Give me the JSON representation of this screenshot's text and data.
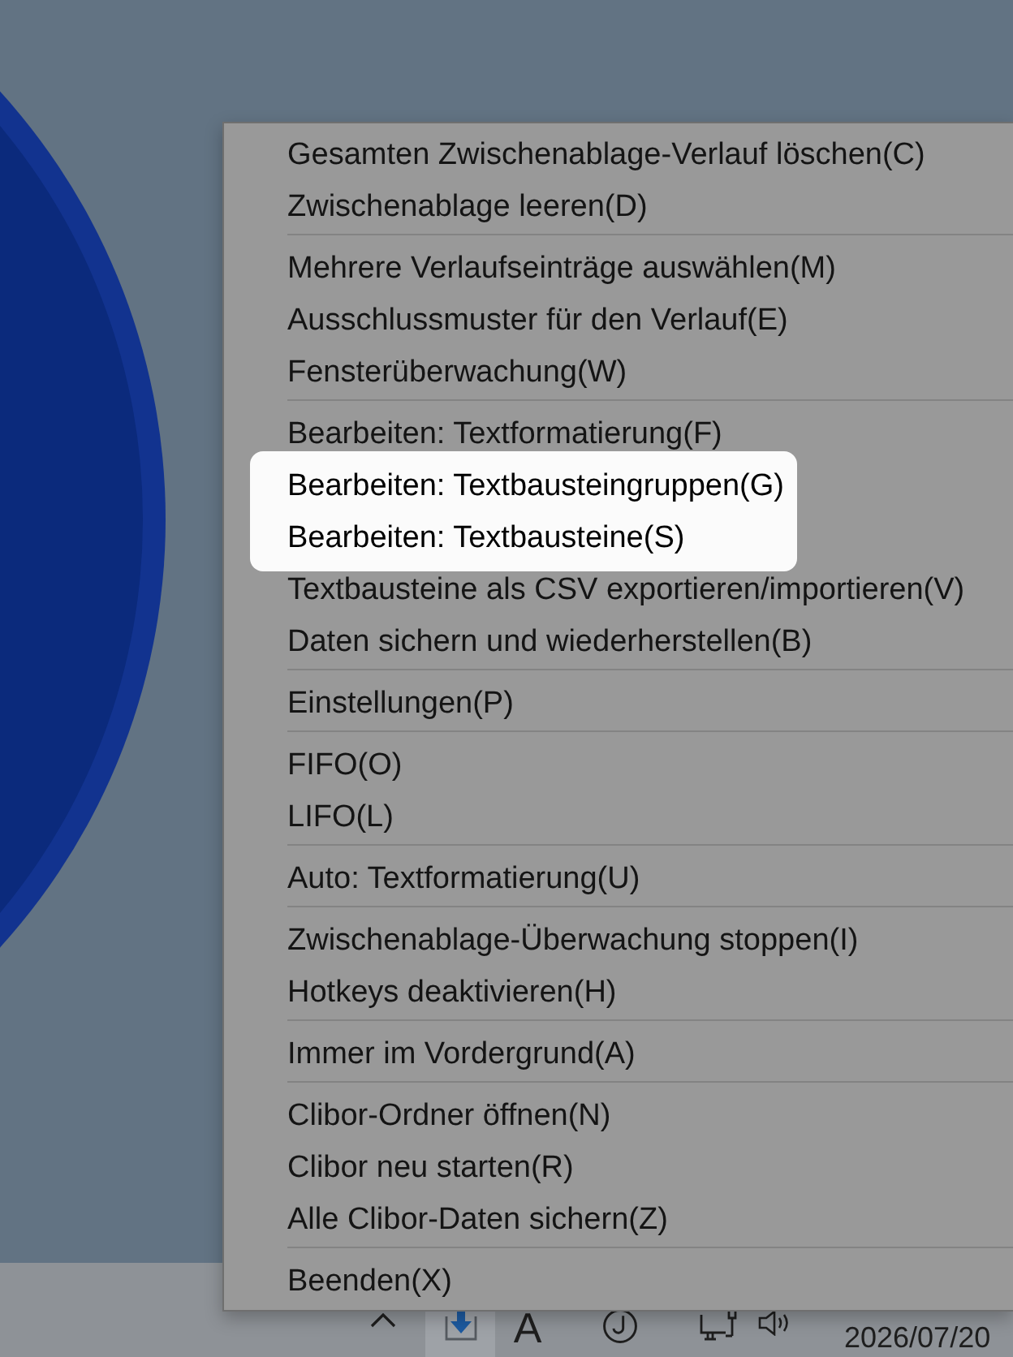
{
  "menu": {
    "entries": [
      {
        "kind": "item",
        "label": "Gesamten Zwischenablage-Verlauf löschen(C)",
        "highlighted": false
      },
      {
        "kind": "item",
        "label": "Zwischenablage leeren(D)",
        "highlighted": false
      },
      {
        "kind": "separator"
      },
      {
        "kind": "item",
        "label": "Mehrere Verlaufseinträge auswählen(M)",
        "highlighted": false
      },
      {
        "kind": "item",
        "label": "Ausschlussmuster für den Verlauf(E)",
        "highlighted": false
      },
      {
        "kind": "item",
        "label": "Fensterüberwachung(W)",
        "highlighted": false
      },
      {
        "kind": "separator"
      },
      {
        "kind": "item",
        "label": "Bearbeiten: Textformatierung(F)",
        "highlighted": false
      },
      {
        "kind": "item",
        "label": "Bearbeiten: Textbausteingruppen(G)",
        "highlighted": true
      },
      {
        "kind": "item",
        "label": "Bearbeiten: Textbausteine(S)",
        "highlighted": true
      },
      {
        "kind": "item",
        "label": "Textbausteine als CSV exportieren/importieren(V)",
        "highlighted": false
      },
      {
        "kind": "item",
        "label": "Daten sichern und wiederherstellen(B)",
        "highlighted": false
      },
      {
        "kind": "separator"
      },
      {
        "kind": "item",
        "label": "Einstellungen(P)",
        "highlighted": false
      },
      {
        "kind": "separator"
      },
      {
        "kind": "item",
        "label": "FIFO(O)",
        "highlighted": false
      },
      {
        "kind": "item",
        "label": "LIFO(L)",
        "highlighted": false
      },
      {
        "kind": "separator"
      },
      {
        "kind": "item",
        "label": "Auto: Textformatierung(U)",
        "highlighted": false
      },
      {
        "kind": "separator"
      },
      {
        "kind": "item",
        "label": "Zwischenablage-Überwachung stoppen(I)",
        "highlighted": false
      },
      {
        "kind": "item",
        "label": "Hotkeys deaktivieren(H)",
        "highlighted": false
      },
      {
        "kind": "separator"
      },
      {
        "kind": "item",
        "label": "Immer im Vordergrund(A)",
        "highlighted": false
      },
      {
        "kind": "separator"
      },
      {
        "kind": "item",
        "label": "Clibor-Ordner öffnen(N)",
        "highlighted": false
      },
      {
        "kind": "item",
        "label": "Clibor neu starten(R)",
        "highlighted": false
      },
      {
        "kind": "item",
        "label": "Alle Clibor-Daten sichern(Z)",
        "highlighted": false
      },
      {
        "kind": "separator"
      },
      {
        "kind": "item",
        "label": "Beenden(X)",
        "highlighted": false
      }
    ]
  },
  "taskbar": {
    "tray": [
      {
        "kind": "chevron",
        "highlighted": false
      },
      {
        "kind": "download",
        "highlighted": true
      },
      {
        "kind": "text",
        "label": "A",
        "highlighted": false
      },
      {
        "kind": "hook-circle",
        "highlighted": false
      },
      {
        "kind": "network",
        "highlighted": false
      },
      {
        "kind": "volume",
        "highlighted": false
      }
    ],
    "date": "2026/07/20"
  }
}
